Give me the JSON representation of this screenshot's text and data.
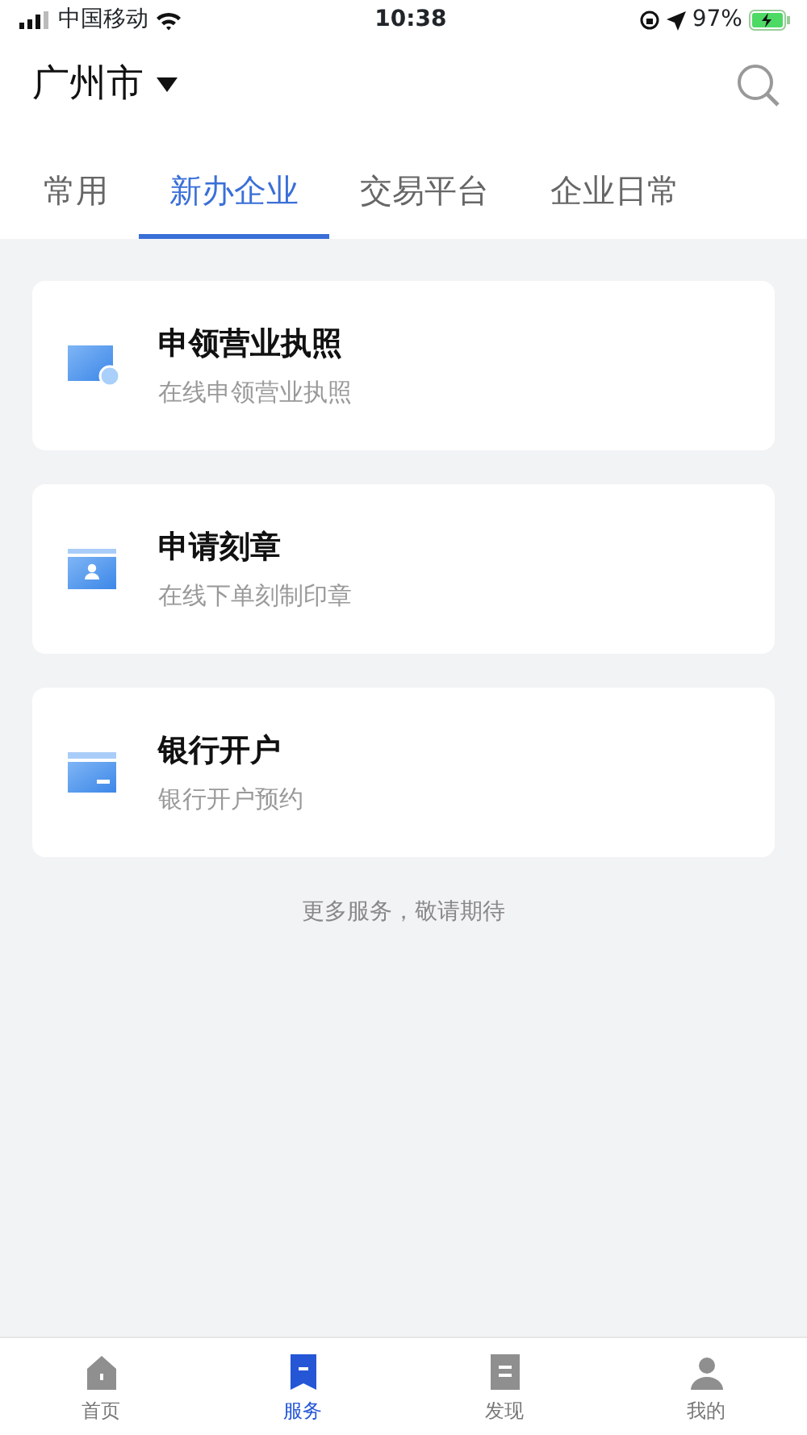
{
  "status_bar": {
    "carrier": "中国移动",
    "time": "10:38",
    "battery": "97%"
  },
  "header": {
    "city": "广州市"
  },
  "tabs": [
    {
      "label": "常用",
      "selected": false
    },
    {
      "label": "新办企业",
      "selected": true
    },
    {
      "label": "交易平台",
      "selected": false
    },
    {
      "label": "企业日常",
      "selected": false
    }
  ],
  "services": [
    {
      "title": "申领营业执照",
      "subtitle": "在线申领营业执照"
    },
    {
      "title": "申请刻章",
      "subtitle": "在线下单刻制印章"
    },
    {
      "title": "银行开户",
      "subtitle": "银行开户预约"
    }
  ],
  "footer_note": "更多服务，敬请期待",
  "bottom_nav": [
    {
      "label": "首页",
      "selected": false
    },
    {
      "label": "服务",
      "selected": true
    },
    {
      "label": "发现",
      "selected": false
    },
    {
      "label": "我的",
      "selected": false
    }
  ]
}
